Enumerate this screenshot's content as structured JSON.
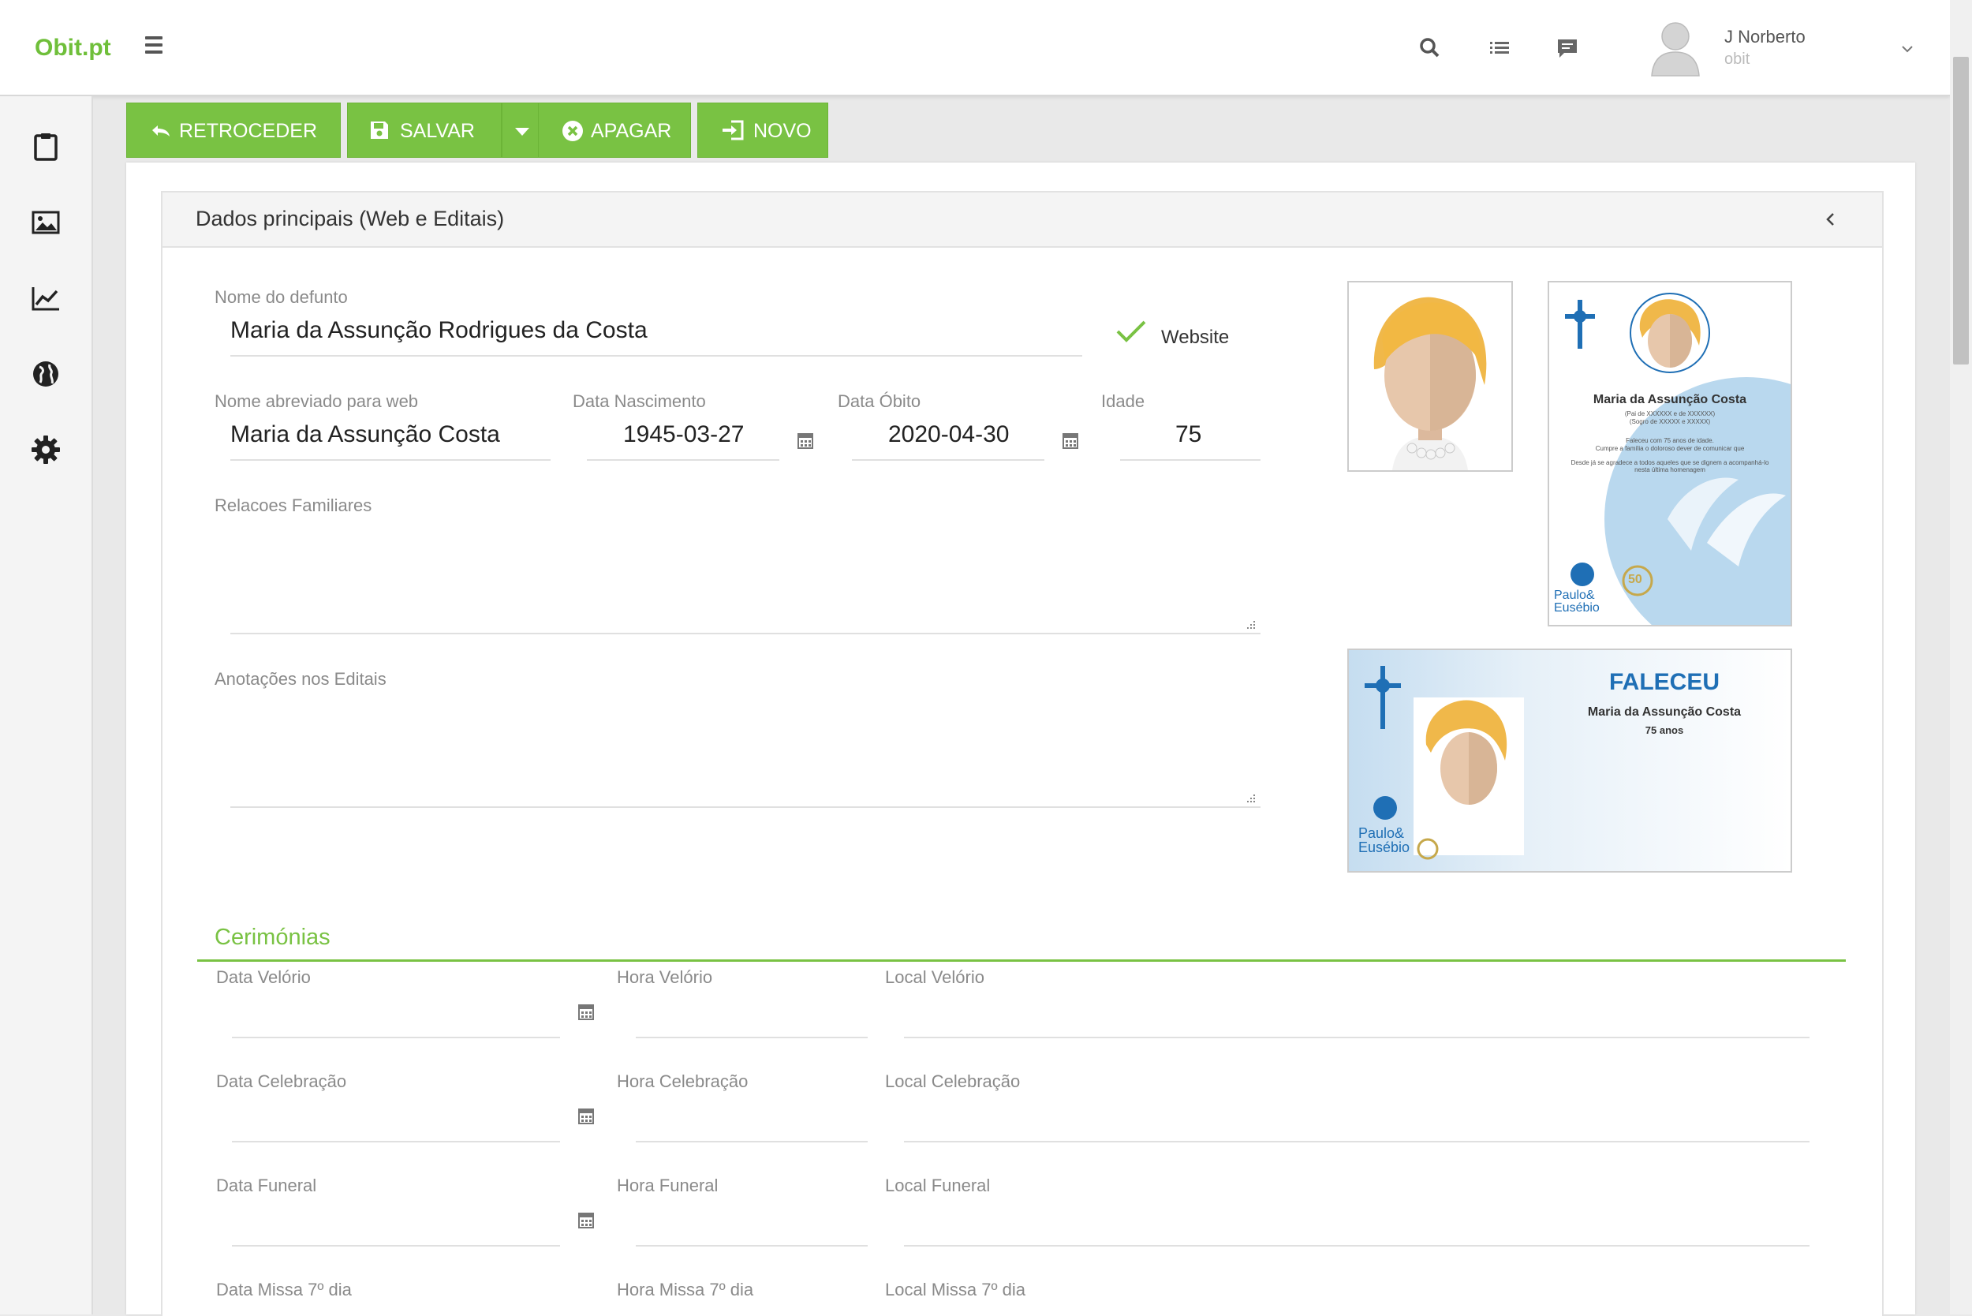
{
  "brand": "Obit.pt",
  "user": {
    "name": "J Norberto",
    "sub": "obit"
  },
  "toolbar": {
    "back_label": "RETROCEDER",
    "save_label": "SALVAR",
    "delete_label": "APAGAR",
    "new_label": "NOVO"
  },
  "panel": {
    "title": "Dados principais (Web e Editais)"
  },
  "form": {
    "nome_label": "Nome do defunto",
    "nome_value": "Maria da Assunção Rodrigues da Costa",
    "website_label": "Website",
    "abrev_label": "Nome abreviado para web",
    "abrev_value": "Maria da Assunção Costa",
    "nasc_label": "Data Nascimento",
    "nasc_value": "1945-03-27",
    "obito_label": "Data Óbito",
    "obito_value": "2020-04-30",
    "idade_label": "Idade",
    "idade_value": "75",
    "relacoes_label": "Relacoes Familiares",
    "anotacoes_label": "Anotações nos Editais"
  },
  "cerimonias": {
    "title": "Cerimónias",
    "rows": [
      {
        "data_label": "Data Velório",
        "hora_label": "Hora Velório",
        "local_label": "Local Velório"
      },
      {
        "data_label": "Data Celebração",
        "hora_label": "Hora Celebração",
        "local_label": "Local Celebração"
      },
      {
        "data_label": "Data Funeral",
        "hora_label": "Hora Funeral",
        "local_label": "Local Funeral"
      },
      {
        "data_label": "Data Missa 7º dia",
        "hora_label": "Hora Missa 7º dia",
        "local_label": "Local Missa 7º dia"
      }
    ]
  },
  "edital": {
    "name": "Maria da Assunção Costa",
    "line1": "(Pai de XXXXXX e de XXXXXX)",
    "line2": "(Sogro de XXXXX e XXXXX)",
    "line3": "Faleceu com 75 anos de idade.",
    "line4": "Cumpre a família o doloroso dever de comunicar que",
    "line5": "Desde já se agradece a todos aqueles que se dignem a acompanhá-lo nesta última homenagem",
    "brand1": "Paulo&",
    "brand2": "Eusébio",
    "badge": "50"
  },
  "facebook_card": {
    "heading": "FALECEU",
    "name": "Maria da Assunção Costa",
    "age": "75 anos",
    "brand1": "Paulo&",
    "brand2": "Eusébio"
  },
  "colors": {
    "accent": "#79c243",
    "brand_blue": "#1f6fb5"
  }
}
